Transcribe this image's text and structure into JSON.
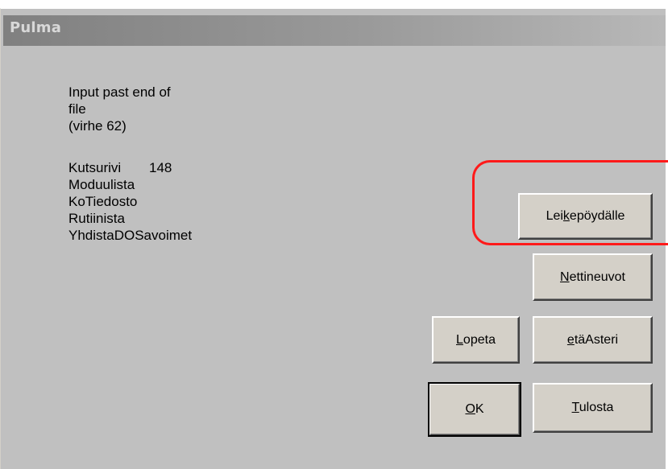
{
  "dialog": {
    "title": "Pulma",
    "message_lines": [
      "Input past end of",
      "file",
      "(virhe 62)"
    ],
    "call_stack": {
      "kutsurivi_label": "Kutsurivi",
      "kutsurivi_value": "148",
      "lines": [
        "Moduulista",
        "KoTiedosto",
        "Rutiinista",
        "YhdistaDOSavoimet"
      ]
    }
  },
  "buttons": {
    "leikepoydalle": {
      "pre": "Lei",
      "accel": "k",
      "post": "epöydälle"
    },
    "nettineuvot": {
      "pre": "",
      "accel": "N",
      "post": "ettineuvot"
    },
    "lopeta": {
      "pre": "",
      "accel": "L",
      "post": "opeta"
    },
    "etaasteri": {
      "pre": "",
      "accel": "e",
      "post": "täAsteri"
    },
    "ok": {
      "pre": "",
      "accel": "O",
      "post": "K"
    },
    "tulosta": {
      "pre": "",
      "accel": "T",
      "post": "ulosta"
    }
  },
  "colors": {
    "dialog_bg": "#c0c0c0",
    "button_face": "#d4d0c8",
    "title_text": "#d8d8d8",
    "highlight": "#ff1a1a"
  }
}
